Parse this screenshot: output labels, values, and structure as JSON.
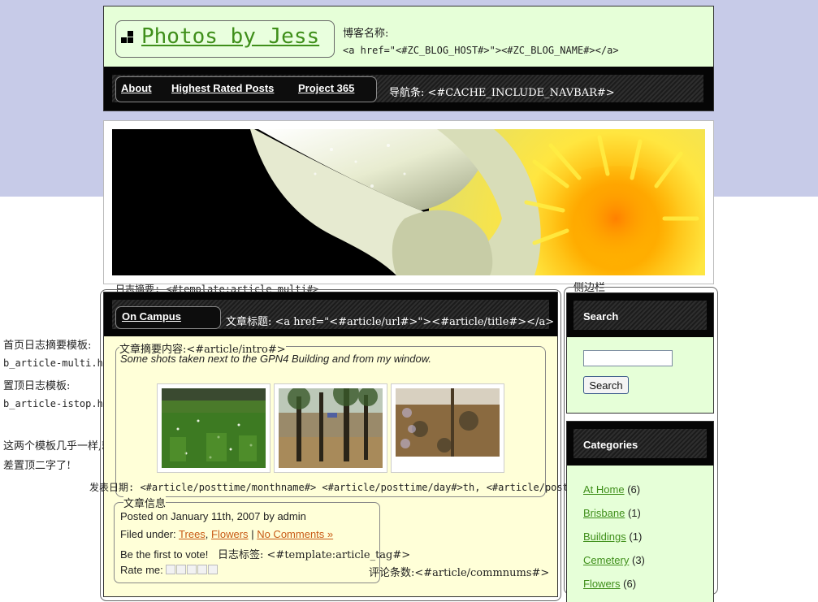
{
  "header": {
    "logo_text": "Photos by Jess",
    "blog_name_label": "博客名称:",
    "blog_name_code": "<a href=\"<#ZC_BLOG_HOST#>\"><#ZC_BLOG_NAME#></a>"
  },
  "nav": {
    "items": [
      {
        "label": "About"
      },
      {
        "label": "Highest Rated Posts"
      },
      {
        "label": "Project 365"
      }
    ],
    "annotation": "导航条: <#CACHE_INCLUDE_NAVBAR#>"
  },
  "annotations": {
    "article_summary": "日志摘要: <#template:article-multi#>",
    "sidebar": "侧边栏",
    "left_notes": [
      "首页日志摘要模板:",
      "b_article-multi.html",
      "置顶日志模板:",
      "b_article-istop.html",
      "这两个模板几乎一样,就",
      "差置顶二字了!"
    ],
    "post_date": "发表日期: <#article/posttime/monthname#> <#article/posttime/day#>th, <#article/posttime/year#>",
    "article_info": "文章信息",
    "intro_label": "文章摘要内容:<#article/intro#>",
    "title_label": "文章标题: <a href=\"<#article/url#>\"><#article/title#></a>",
    "tags_label": "日志标签: <#template:article_tag#>",
    "comments_label": "评论条数:<#article/commnums#>"
  },
  "post": {
    "title": "On Campus",
    "intro": "Some shots taken next to the GPN4 Building and from my window.",
    "posted": "Posted on January 11th, 2007 by admin",
    "filed_under_label": "Filed under:",
    "tags": [
      "Trees",
      "Flowers"
    ],
    "tag_separator": ",",
    "comments_link": "No Comments »",
    "vote_text": "Be the first to vote!",
    "rate_label": "Rate me:"
  },
  "sidebar": {
    "search": {
      "title": "Search",
      "input_value": "",
      "button_label": "Search"
    },
    "categories": {
      "title": "Categories",
      "items": [
        {
          "name": "At Home",
          "count": "(6)"
        },
        {
          "name": "Brisbane",
          "count": "(1)"
        },
        {
          "name": "Buildings",
          "count": "(1)"
        },
        {
          "name": "Cemetery",
          "count": "(3)"
        },
        {
          "name": "Flowers",
          "count": "(6)"
        }
      ]
    }
  },
  "colors": {
    "header_bg": "#e6ffd8",
    "content_bg": "#ffffd8",
    "link_green": "#3f8f1a",
    "link_orange": "#c85a14",
    "page_band": "#c7cbe8"
  }
}
